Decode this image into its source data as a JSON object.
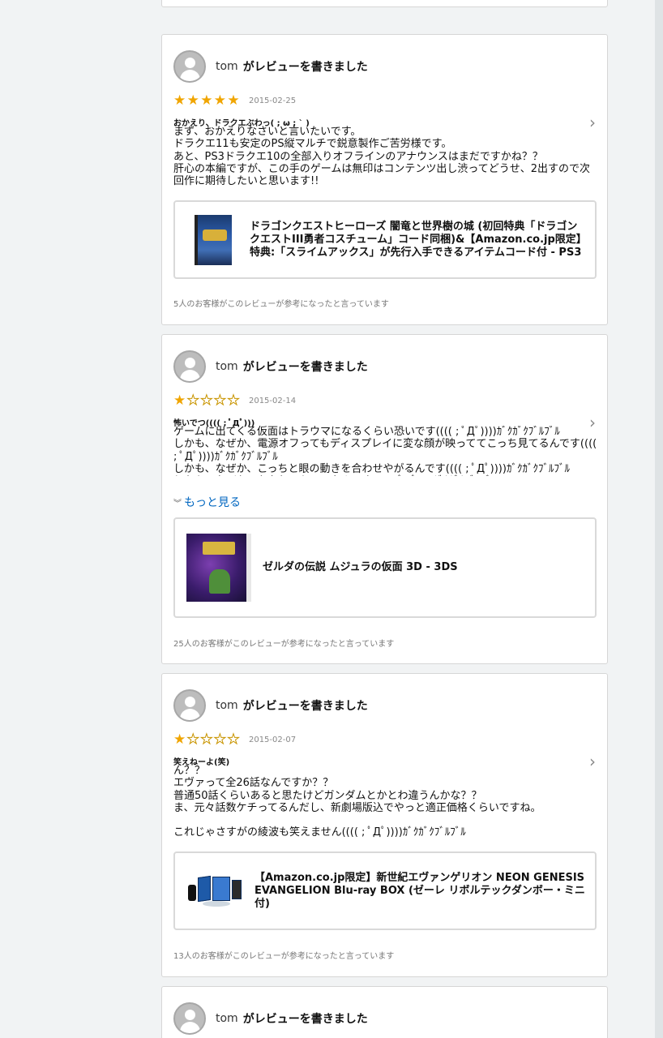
{
  "reviews": [
    {
      "user": "tom",
      "action": "がレビューを書きました",
      "rating": 5,
      "date": "2015-02-25",
      "title": "おかえり、ドラクエぶわっ( ; ω ; ` )",
      "body": "まず、おかえりなさいと言いたいです。\nドラクエ11も安定のPS縦マルチで鋭意製作ご苦労様です。\nあと、PS3ドラクエ10の全部入りオフラインのアナウンスはまだですかね？？\n肝心の本編ですが、この手のゲームは無印はコンテンツ出し渋ってどうせ、2出すので次回作に期待したいと思います!!",
      "more_label": "",
      "product_title": "ドラゴンクエストヒーローズ 闇竜と世界樹の城 (初回特典「ドラゴンクエストIII勇者コスチューム」コード同梱)&【Amazon.co.jp限定】特典:「スライムアックス」が先行入手できるアイテムコード付 - PS3",
      "helpful": "5人のお客様がこのレビューが参考になったと言っています"
    },
    {
      "user": "tom",
      "action": "がレビューを書きました",
      "rating": 1,
      "date": "2015-02-14",
      "title": "怖いでつ(((( ; ﾟДﾟ)))",
      "body": "ゲームに出てくる仮面はトラウマになるくらい恐いです(((( ; ﾟДﾟ))))ｶﾞｸｶﾞｸﾌﾞﾙﾌﾞﾙ\nしかも、なぜか、電源オフってもディスプレイに変な顔が映っててこっち見てるんです(((( ; ﾟДﾟ))))ｶﾞｸｶﾞｸﾌﾞﾙﾌﾞﾙ\nしかも、なぜか、こっちと眼の動きを合わせやがるんです(((( ; ﾟДﾟ))))ｶﾞｸｶﾞｸﾌﾞﾙﾌﾞﾙ\nしかも、なぜか、かなりイケメンなんです(((( ; ﾟДﾟ))))ｶﾞｸｶﾞｸﾌﾞﾙﾌﾞﾙ",
      "more_label": "もっと見る",
      "product_title": "ゼルダの伝説 ムジュラの仮面 3D - 3DS",
      "helpful": "25人のお客様がこのレビューが参考になったと言っています"
    },
    {
      "user": "tom",
      "action": "がレビューを書きました",
      "rating": 1,
      "date": "2015-02-07",
      "title": "笑えねーよ(笑)",
      "body": "ん？？\nエヴァって全26話なんですか？？\n普通50話くらいあると思たけどガンダムとかとわ違うんかな？？\nま、元々話数ケチってるんだし、新劇場版込でやっと適正価格くらいですね。\n\nこれじゃさすがの綾波も笑えません(((( ; ﾟДﾟ))))ｶﾞｸｶﾞｸﾌﾞﾙﾌﾞﾙ",
      "more_label": "",
      "product_title": "【Amazon.co.jp限定】新世紀エヴァンゲリオン NEON GENESIS EVANGELION Blu-ray BOX (ゼーレ リボルテックダンボー・ミニ付)",
      "helpful": "13人のお客様がこのレビューが参考になったと言っています"
    },
    {
      "user": "tom",
      "action": "がレビューを書きました"
    }
  ],
  "icons": {
    "avatar": "default-user-avatar",
    "chevron": "chevron-right-icon",
    "more": "double-chevron-down-icon",
    "star_filled_color": "#f0a500"
  }
}
